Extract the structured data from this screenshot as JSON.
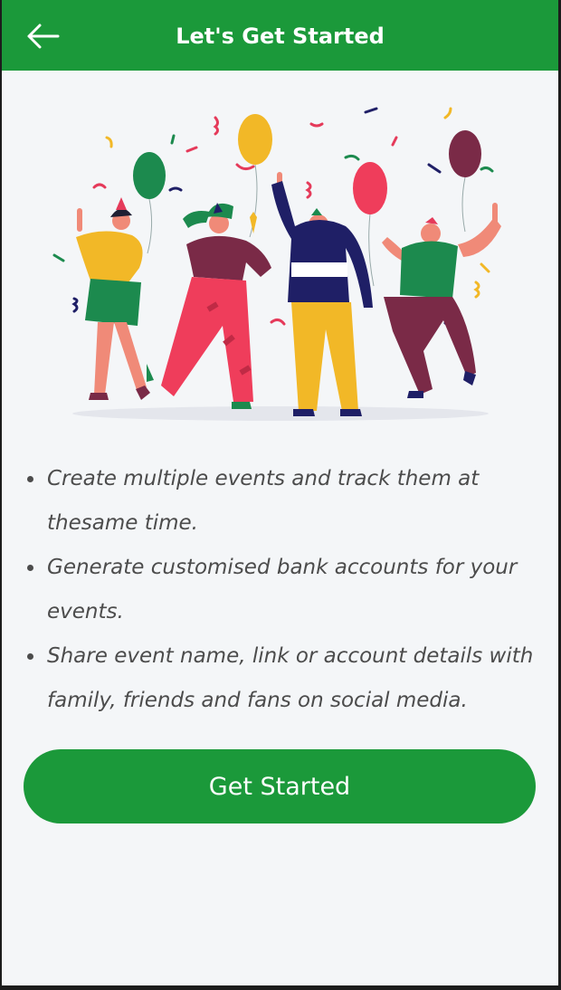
{
  "header": {
    "title": "Let's Get Started",
    "back_icon": "arrow-left-icon"
  },
  "hero": {
    "icon": "party-celebration-illustration"
  },
  "features": [
    "Create multiple events and track them at thesame time.",
    "Generate customised bank accounts for your events.",
    "Share event name, link or account details with family, friends and fans on social media."
  ],
  "cta": {
    "label": "Get Started"
  },
  "colors": {
    "primary": "#1b993a",
    "background": "#f4f6f8",
    "text": "#4c4c4c"
  }
}
